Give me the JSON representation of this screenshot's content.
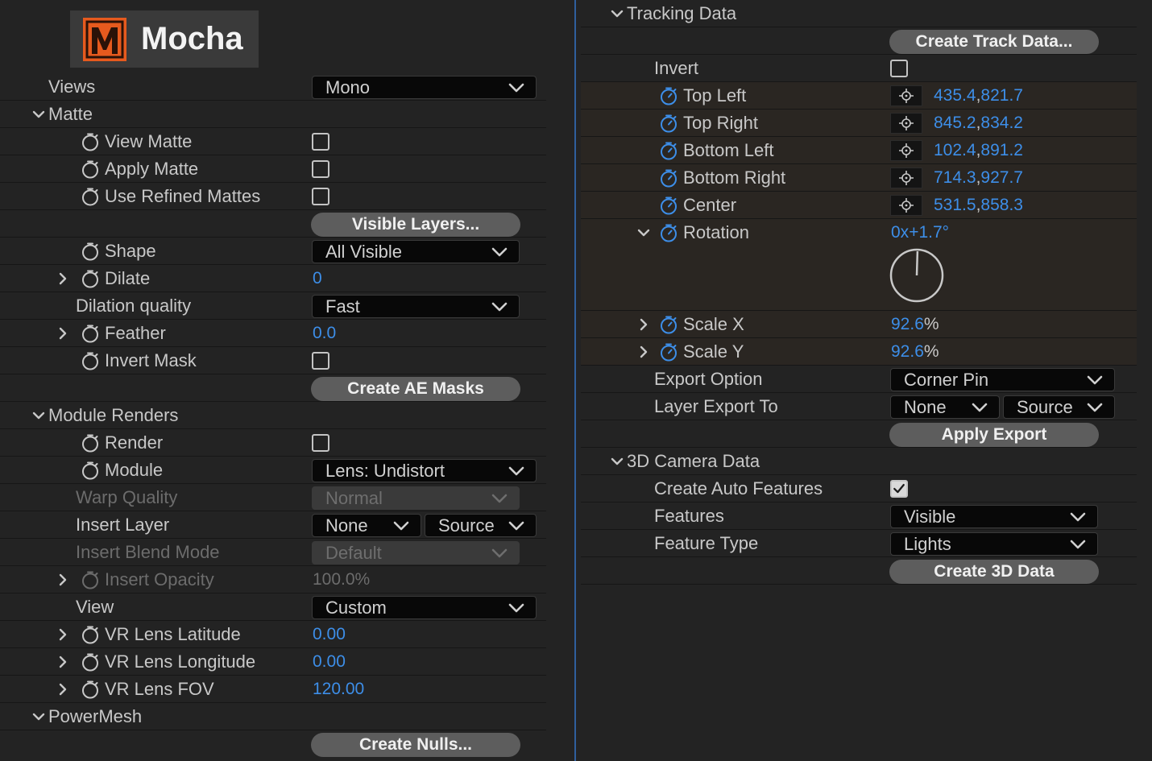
{
  "logo": {
    "text": "Mocha"
  },
  "colors": {
    "accent": "#3d8ee8",
    "brand": "#e65a1e",
    "divider": "#2f5f9e"
  },
  "left": {
    "views": {
      "label": "Views",
      "value": "Mono"
    },
    "matte": {
      "header": "Matte",
      "view_matte": "View Matte",
      "apply_matte": "Apply Matte",
      "use_refined_mattes": "Use Refined Mattes",
      "visible_layers_button": "Visible Layers...",
      "shape": {
        "label": "Shape",
        "value": "All Visible"
      },
      "dilate": {
        "label": "Dilate",
        "value": "0"
      },
      "dilation_quality": {
        "label": "Dilation quality",
        "value": "Fast"
      },
      "feather": {
        "label": "Feather",
        "value": "0.0"
      },
      "invert_mask": "Invert Mask",
      "create_ae_masks_button": "Create AE Masks"
    },
    "module_renders": {
      "header": "Module Renders",
      "render": "Render",
      "module": {
        "label": "Module",
        "value": "Lens: Undistort"
      },
      "warp_quality": {
        "label": "Warp Quality",
        "value": "Normal"
      },
      "insert_layer": {
        "label": "Insert Layer",
        "value1": "None",
        "value2": "Source"
      },
      "insert_blend_mode": {
        "label": "Insert Blend Mode",
        "value": "Default"
      },
      "insert_opacity": {
        "label": "Insert Opacity",
        "value": "100.0%"
      },
      "view": {
        "label": "View",
        "value": "Custom"
      },
      "vr_lens_latitude": {
        "label": "VR Lens Latitude",
        "value": "0.00"
      },
      "vr_lens_longitude": {
        "label": "VR Lens Longitude",
        "value": "0.00"
      },
      "vr_lens_fov": {
        "label": "VR Lens FOV",
        "value": "120.00"
      }
    },
    "powermesh": {
      "header": "PowerMesh",
      "create_nulls_button": "Create Nulls..."
    }
  },
  "right": {
    "tracking": {
      "header": "Tracking Data",
      "create_track_button": "Create Track Data...",
      "invert": "Invert",
      "top_left": {
        "label": "Top Left",
        "x": "435.4",
        "y": "821.7"
      },
      "top_right": {
        "label": "Top Right",
        "x": "845.2",
        "y": "834.2"
      },
      "bottom_left": {
        "label": "Bottom Left",
        "x": "102.4",
        "y": "891.2"
      },
      "bottom_right": {
        "label": "Bottom Right",
        "x": "714.3",
        "y": "927.7"
      },
      "center": {
        "label": "Center",
        "x": "531.5",
        "y": "858.3"
      },
      "rotation": {
        "label": "Rotation",
        "revolutions": "0x",
        "degrees": "+1.7°"
      },
      "scale_x": {
        "label": "Scale X",
        "value": "92.6",
        "unit": "%"
      },
      "scale_y": {
        "label": "Scale Y",
        "value": "92.6",
        "unit": "%"
      },
      "export_option": {
        "label": "Export Option",
        "value": "Corner Pin"
      },
      "layer_export_to": {
        "label": "Layer Export To",
        "value1": "None",
        "value2": "Source"
      },
      "apply_export_button": "Apply Export"
    },
    "camera": {
      "header": "3D Camera Data",
      "create_auto_features": "Create Auto Features",
      "features": {
        "label": "Features",
        "value": "Visible"
      },
      "feature_type": {
        "label": "Feature Type",
        "value": "Lights"
      },
      "create_3d_button": "Create 3D Data"
    }
  }
}
